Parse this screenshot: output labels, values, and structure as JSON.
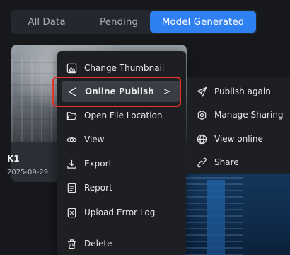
{
  "tabs": [
    {
      "label": "All Data"
    },
    {
      "label": "Pending"
    },
    {
      "label": "Model Generated",
      "active": true
    }
  ],
  "card": {
    "title": "K1",
    "date": "2025-09-29 1"
  },
  "context_menu": {
    "items": [
      {
        "label": "Change Thumbnail",
        "icon": "image-icon"
      },
      {
        "label": "Online Publish",
        "icon": "share-nodes-icon",
        "highlighted": true,
        "submenu_indicator": ">"
      },
      {
        "label": "Open File Location",
        "icon": "folder-open-icon"
      },
      {
        "label": "View",
        "icon": "eye-icon"
      },
      {
        "label": "Export",
        "icon": "download-icon"
      },
      {
        "label": "Report",
        "icon": "document-icon"
      },
      {
        "label": "Upload Error Log",
        "icon": "file-error-icon"
      },
      {
        "label": "Delete",
        "icon": "trash-icon"
      }
    ]
  },
  "submenu": {
    "items": [
      {
        "label": "Publish again",
        "icon": "send-icon"
      },
      {
        "label": "Manage Sharing",
        "icon": "settings-share-icon"
      },
      {
        "label": "View online",
        "icon": "globe-icon"
      },
      {
        "label": "Share",
        "icon": "link-icon"
      }
    ]
  },
  "colors": {
    "accent": "#2f80f0",
    "highlight_border": "#e2322b",
    "menu_bg": "#1d1f23"
  }
}
